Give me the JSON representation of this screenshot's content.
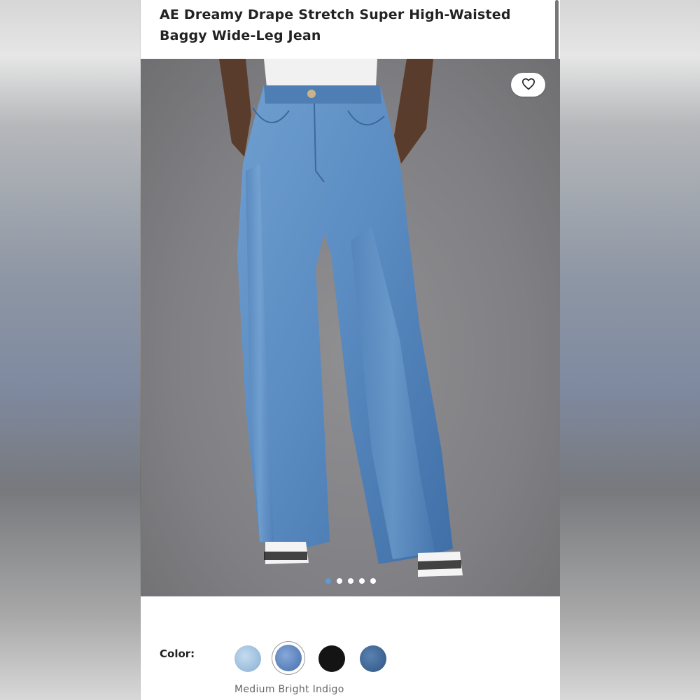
{
  "product": {
    "title": "AE Dreamy Drape Stretch Super High-Waisted Baggy Wide-Leg Jean"
  },
  "gallery": {
    "favorite_icon": "heart-outline-icon",
    "image_count": 5,
    "active_index": 0
  },
  "color_selector": {
    "label": "Color:",
    "selected_name": "Medium Bright Indigo",
    "swatches": [
      {
        "name": "light-wash",
        "color": "#9fc0de"
      },
      {
        "name": "medium-bright-indigo",
        "color": "#5f85bf"
      },
      {
        "name": "black",
        "color": "#141414"
      },
      {
        "name": "dark-wash",
        "color": "#3f6695"
      }
    ],
    "selected_index": 1
  },
  "colors": {
    "active_dot": "#5d9ad6",
    "text": "#222222"
  }
}
